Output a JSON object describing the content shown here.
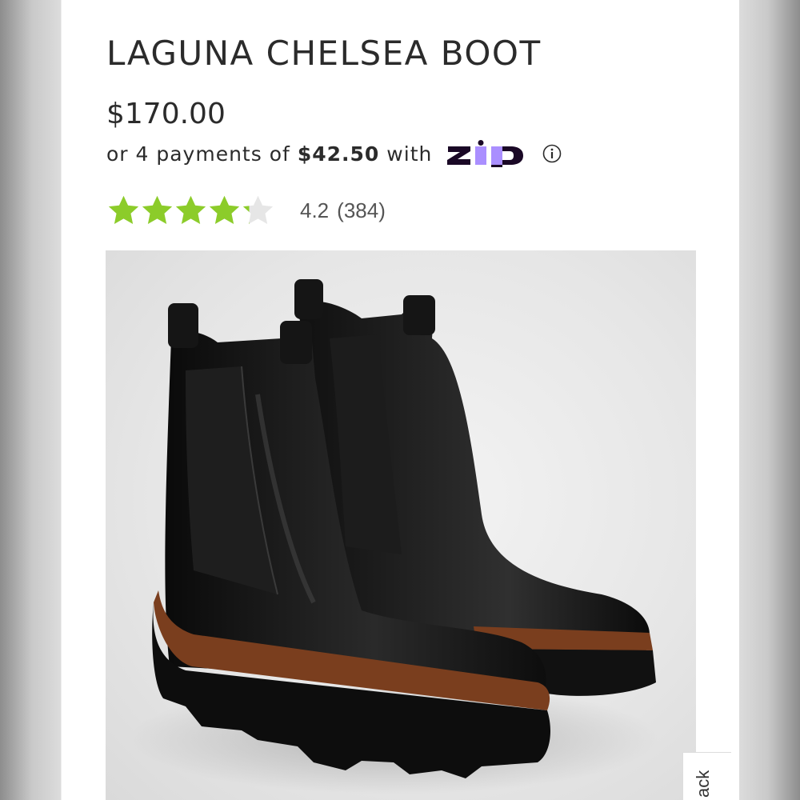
{
  "product": {
    "title": "LAGUNA CHELSEA BOOT",
    "price": "$170.00",
    "installments": {
      "prefix": "or 4 payments of",
      "amount": "$42.50",
      "suffix": "with",
      "provider_icon": "zip-logo",
      "info_icon": "info-icon"
    },
    "rating": {
      "value": "4.2",
      "count": "(384)",
      "stars_filled_fraction": 0.84,
      "star_color": "#8ccc2a",
      "star_empty_color": "#e6e6e6"
    },
    "image": {
      "alt": "Laguna Chelsea Boot, black leather with brown welt and lug sole",
      "colors": {
        "leather": "#141414",
        "welt": "#7a3e1e",
        "background": "#e6e6e6"
      }
    }
  },
  "feedback_tab": {
    "label": "Feedback",
    "visible_text": "ack"
  },
  "colors": {
    "text": "#2b2b2b",
    "zip_purple": "#aa8fff",
    "zip_dark": "#1a0826"
  }
}
